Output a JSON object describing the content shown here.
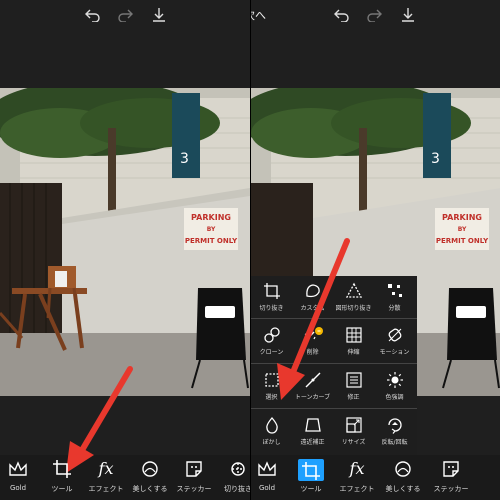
{
  "topbar": {
    "next_label": "次へ"
  },
  "photo": {
    "sign_line1": "PARKING",
    "sign_line2": "BY",
    "sign_line3": "PERMIT ONLY"
  },
  "bottom_tools": [
    {
      "label": "Gold"
    },
    {
      "label": "ツール"
    },
    {
      "label": "エフェクト"
    },
    {
      "label": "美しくする"
    },
    {
      "label": "ステッカー"
    },
    {
      "label": "切り抜き"
    }
  ],
  "tool_menu": {
    "items": [
      {
        "label": "切り抜き"
      },
      {
        "label": "カスタム"
      },
      {
        "label": "図形切り抜き"
      },
      {
        "label": "分散"
      },
      {
        "label": "クローン"
      },
      {
        "label": "削除"
      },
      {
        "label": "伸縮"
      },
      {
        "label": "モーション"
      },
      {
        "label": "選択"
      },
      {
        "label": "トーンカーブ"
      },
      {
        "label": "修正"
      },
      {
        "label": "色強調"
      },
      {
        "label": "ぼかし"
      },
      {
        "label": "遠近補正"
      },
      {
        "label": "リサイズ"
      },
      {
        "label": "反転/回転"
      }
    ]
  },
  "colors": {
    "accent": "#1ea0ff",
    "arrow": "#e8382d"
  }
}
